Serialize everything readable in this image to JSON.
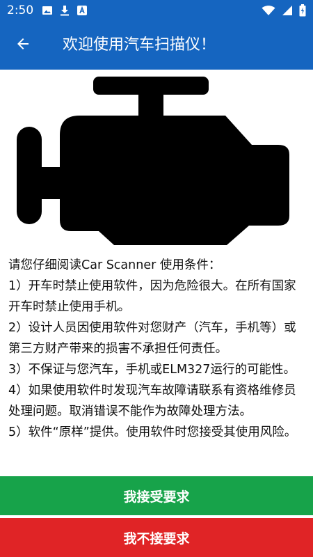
{
  "status_bar": {
    "time": "2:50",
    "icons": [
      "image-icon",
      "download-icon",
      "font-icon",
      "wifi-icon",
      "signal-icon",
      "battery-icon"
    ]
  },
  "app_bar": {
    "title": "欢迎使用汽车扫描仪！",
    "back_icon": "arrow-left-icon"
  },
  "content": {
    "image_icon": "engine-icon",
    "terms": [
      "请您仔细阅读Car Scanner 使用条件：",
      "1）开车时禁止使用软件，因为危险很大。在所有国家开车时禁止使用手机。",
      "2）设计人员因使用软件对您财产（汽车，手机等）或第三方财产带来的损害不承担任何责任。",
      "3）不保证与您汽车，手机或ELM327运行的可能性。",
      "4）如果使用软件时发现汽车故障请联系有资格维修员处理问题。取消错误不能作为故障处理方法。",
      "5）软件“原样”提供。使用软件时您接受其使用风险。"
    ]
  },
  "buttons": {
    "accept_label": "我接受要求",
    "decline_label": "我不接要求"
  },
  "colors": {
    "primary": "#1565c0",
    "accept": "#17a34a",
    "decline": "#e02426"
  }
}
